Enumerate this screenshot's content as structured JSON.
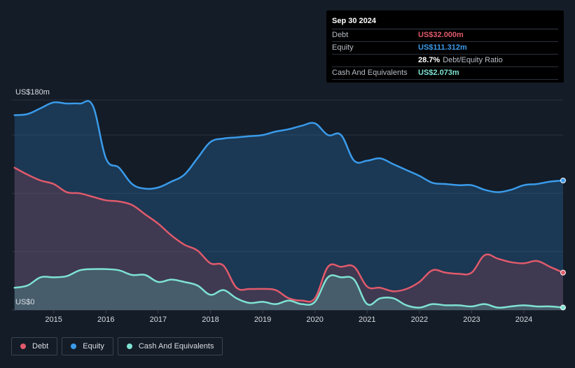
{
  "tooltip": {
    "date": "Sep 30 2024",
    "rows": [
      {
        "label": "Debt",
        "value": "US$32.000m",
        "color": "#e05a6b"
      },
      {
        "label": "Equity",
        "value": "US$111.312m",
        "color": "#3a9bea"
      },
      {
        "label": "",
        "value": "28.7%",
        "extra": "Debt/Equity Ratio",
        "color": "#ffffff"
      },
      {
        "label": "Cash And Equivalents",
        "value": "US$2.073m",
        "color": "#7ee2d2"
      }
    ]
  },
  "legend": [
    {
      "label": "Debt",
      "color": "#e05a6b"
    },
    {
      "label": "Equity",
      "color": "#3a9bea"
    },
    {
      "label": "Cash And Equivalents",
      "color": "#7ee2d2"
    }
  ],
  "chart_data": {
    "type": "area",
    "ylabel_top": "US$180m",
    "ylabel_bottom": "US$0",
    "ylim": [
      0,
      180
    ],
    "xlim": [
      2014.2,
      2024.75
    ],
    "xticks": [
      "2015",
      "2016",
      "2017",
      "2018",
      "2019",
      "2020",
      "2021",
      "2022",
      "2023",
      "2024"
    ],
    "series": [
      {
        "name": "Debt",
        "color": "#e05a6b",
        "x": [
          2014.25,
          2014.5,
          2014.75,
          2015.0,
          2015.25,
          2015.5,
          2015.75,
          2016.0,
          2016.25,
          2016.5,
          2016.75,
          2017.0,
          2017.25,
          2017.5,
          2017.75,
          2018.0,
          2018.25,
          2018.5,
          2018.75,
          2019.0,
          2019.25,
          2019.5,
          2019.75,
          2020.0,
          2020.25,
          2020.5,
          2020.75,
          2021.0,
          2021.25,
          2021.5,
          2021.75,
          2022.0,
          2022.25,
          2022.5,
          2022.75,
          2023.0,
          2023.25,
          2023.5,
          2023.75,
          2024.0,
          2024.25,
          2024.5,
          2024.75
        ],
        "values": [
          122,
          116,
          111,
          108,
          101,
          100,
          97,
          94,
          93,
          90,
          82,
          74,
          64,
          56,
          51,
          40,
          38,
          19,
          18,
          18,
          17,
          10,
          8,
          10,
          37,
          37,
          37,
          20,
          19,
          16,
          18,
          24,
          34,
          32,
          31,
          32,
          47,
          44,
          41,
          40,
          42,
          37,
          32
        ]
      },
      {
        "name": "Equity",
        "color": "#3a9bea",
        "x": [
          2014.25,
          2014.5,
          2014.75,
          2015.0,
          2015.25,
          2015.5,
          2015.75,
          2016.0,
          2016.25,
          2016.5,
          2016.75,
          2017.0,
          2017.25,
          2017.5,
          2017.75,
          2018.0,
          2018.25,
          2018.5,
          2018.75,
          2019.0,
          2019.25,
          2019.5,
          2019.75,
          2020.0,
          2020.25,
          2020.5,
          2020.75,
          2021.0,
          2021.25,
          2021.5,
          2021.75,
          2022.0,
          2022.25,
          2022.5,
          2022.75,
          2023.0,
          2023.25,
          2023.5,
          2023.75,
          2024.0,
          2024.25,
          2024.5,
          2024.75
        ],
        "values": [
          167,
          168,
          173,
          178,
          177,
          177,
          175,
          130,
          122,
          108,
          104,
          105,
          110,
          116,
          130,
          144,
          147,
          148,
          149,
          150,
          153,
          155,
          158,
          160,
          150,
          150,
          128,
          128,
          130,
          125,
          120,
          115,
          109,
          108,
          107,
          107,
          103,
          101,
          103,
          107,
          108,
          110,
          111
        ]
      },
      {
        "name": "Cash And Equivalents",
        "color": "#7ee2d2",
        "x": [
          2014.25,
          2014.5,
          2014.75,
          2015.0,
          2015.25,
          2015.5,
          2015.75,
          2016.0,
          2016.25,
          2016.5,
          2016.75,
          2017.0,
          2017.25,
          2017.5,
          2017.75,
          2018.0,
          2018.25,
          2018.5,
          2018.75,
          2019.0,
          2019.25,
          2019.5,
          2019.75,
          2020.0,
          2020.25,
          2020.5,
          2020.75,
          2021.0,
          2021.25,
          2021.5,
          2021.75,
          2022.0,
          2022.25,
          2022.5,
          2022.75,
          2023.0,
          2023.25,
          2023.5,
          2023.75,
          2024.0,
          2024.25,
          2024.5,
          2024.75
        ],
        "values": [
          19,
          21,
          28,
          28,
          29,
          34,
          35,
          35,
          34,
          30,
          30,
          24,
          26,
          24,
          21,
          13,
          17,
          10,
          6,
          7,
          5,
          8,
          5,
          7,
          28,
          28,
          26,
          5,
          10,
          10,
          4,
          2,
          5,
          4,
          4,
          3,
          5,
          2,
          3,
          4,
          3,
          3,
          2.073
        ]
      }
    ]
  }
}
